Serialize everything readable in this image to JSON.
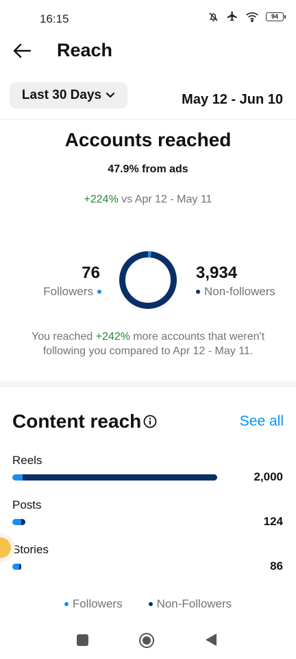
{
  "status_bar": {
    "time": "16:15",
    "battery": "94"
  },
  "header": {
    "title": "Reach"
  },
  "filter": {
    "range_label": "Last 30 Days",
    "date_range": "May 12 - Jun 10"
  },
  "accounts_reached": {
    "title": "Accounts reached",
    "from_ads": "47.9% from ads",
    "change": "+224%",
    "compare_text": " vs Apr 12 - May 11",
    "followers_count": "76",
    "followers_label": "Followers",
    "non_followers_count": "3,934",
    "non_followers_label": "Non-followers",
    "note_prefix": "You reached ",
    "note_change": "+242%",
    "note_suffix": " more accounts that weren't following you compared to Apr 12 - May 11."
  },
  "content_reach": {
    "title": "Content reach",
    "see_all": "See all",
    "rows": [
      {
        "label": "Reels",
        "value": "2,000",
        "followers_share": 0.05,
        "total_share": 1.0
      },
      {
        "label": "Posts",
        "value": "124",
        "followers_share": 0.7,
        "total_share": 0.062
      },
      {
        "label": "Stories",
        "value": "86",
        "followers_share": 0.8,
        "total_share": 0.043
      }
    ],
    "legend": {
      "followers": "Followers",
      "non_followers": "Non-Followers"
    }
  },
  "colors": {
    "followers": "#1d8cf0",
    "non_followers": "#0a2f66",
    "positive": "#1f8a3b",
    "link": "#0095f6"
  },
  "icons": {
    "back": "arrow-left-icon",
    "dropdown": "chevron-down-icon",
    "info": "info-icon",
    "mute": "bell-off-icon",
    "airplane": "airplane-icon",
    "wifi": "wifi-icon",
    "battery": "battery-icon"
  }
}
